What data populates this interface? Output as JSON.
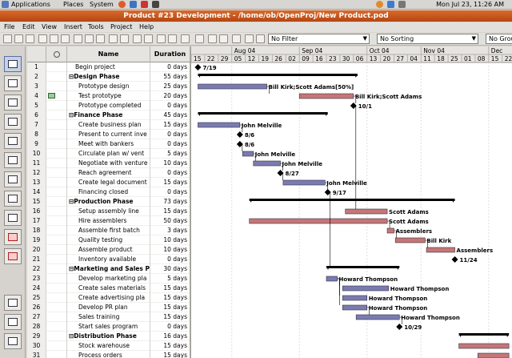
{
  "topbar": {
    "menus": [
      "Applications",
      "Places",
      "System"
    ],
    "clock": "Mon Jul 23, 11:26 AM"
  },
  "window": {
    "title": "Product #23 Development - /home/ob/OpenProj/New Product.pod"
  },
  "menubar": [
    "File",
    "Edit",
    "View",
    "Insert",
    "Tools",
    "Project",
    "Help"
  ],
  "toolbar": {
    "filter": "No Filter",
    "sorting": "No Sorting",
    "group": "No Grou"
  },
  "sidebar": {
    "icons": [
      "gantt-view-icon",
      "network-view-icon",
      "wbs-view-icon",
      "task-usage-icon",
      "resource-usage-icon",
      "resource-view-icon",
      "rbs-view-icon",
      "projects-view-icon",
      "report-icon",
      "task-sheet-icon",
      "resource-sheet-icon",
      "histogram-icon",
      "charts-icon",
      "task-usage-detail-icon"
    ]
  },
  "table": {
    "headers": [
      "",
      "Name",
      "Duration"
    ],
    "rows": [
      {
        "id": "1",
        "name": "Begin project",
        "dur": "0 days",
        "summary": false,
        "level": 0
      },
      {
        "id": "2",
        "name": "Design Phase",
        "dur": "55 days",
        "summary": true,
        "level": 0
      },
      {
        "id": "3",
        "name": "Prototype design",
        "dur": "25 days",
        "summary": false,
        "level": 1
      },
      {
        "id": "4",
        "name": "Test prototype",
        "dur": "20 days",
        "summary": false,
        "level": 1
      },
      {
        "id": "5",
        "name": "Prototype completed",
        "dur": "0 days",
        "summary": false,
        "level": 1
      },
      {
        "id": "6",
        "name": "Finance Phase",
        "dur": "45 days",
        "summary": true,
        "level": 0
      },
      {
        "id": "7",
        "name": "Create business plan",
        "dur": "15 days",
        "summary": false,
        "level": 1
      },
      {
        "id": "8",
        "name": "Present to current inve",
        "dur": "0 days",
        "summary": false,
        "level": 1
      },
      {
        "id": "9",
        "name": "Meet with bankers",
        "dur": "0 days",
        "summary": false,
        "level": 1
      },
      {
        "id": "10",
        "name": "Circulate plan w/ vent",
        "dur": "5 days",
        "summary": false,
        "level": 1
      },
      {
        "id": "11",
        "name": "Negotiate with venture",
        "dur": "10 days",
        "summary": false,
        "level": 1
      },
      {
        "id": "12",
        "name": "Reach agreement",
        "dur": "0 days",
        "summary": false,
        "level": 1
      },
      {
        "id": "13",
        "name": "Create legal document",
        "dur": "15 days",
        "summary": false,
        "level": 1
      },
      {
        "id": "14",
        "name": "Financing closed",
        "dur": "0 days",
        "summary": false,
        "level": 1
      },
      {
        "id": "15",
        "name": "Production Phase",
        "dur": "73 days",
        "summary": true,
        "level": 0
      },
      {
        "id": "16",
        "name": "Setup assembly line",
        "dur": "15 days",
        "summary": false,
        "level": 1
      },
      {
        "id": "17",
        "name": "Hire assemblers",
        "dur": "50 days",
        "summary": false,
        "level": 1
      },
      {
        "id": "18",
        "name": "Assemble first batch",
        "dur": "3 days",
        "summary": false,
        "level": 1
      },
      {
        "id": "19",
        "name": "Quality testing",
        "dur": "10 days",
        "summary": false,
        "level": 1
      },
      {
        "id": "20",
        "name": "Assemble product",
        "dur": "10 days",
        "summary": false,
        "level": 1
      },
      {
        "id": "21",
        "name": "Inventory available",
        "dur": "0 days",
        "summary": false,
        "level": 1
      },
      {
        "id": "22",
        "name": "Marketing and Sales P",
        "dur": "30 days",
        "summary": true,
        "level": 0
      },
      {
        "id": "23",
        "name": "Develop marketing pla",
        "dur": "5 days",
        "summary": false,
        "level": 1
      },
      {
        "id": "24",
        "name": "Create sales materials",
        "dur": "15 days",
        "summary": false,
        "level": 1
      },
      {
        "id": "25",
        "name": "Create advertising pla",
        "dur": "15 days",
        "summary": false,
        "level": 1
      },
      {
        "id": "26",
        "name": "Develop PR plan",
        "dur": "15 days",
        "summary": false,
        "level": 1
      },
      {
        "id": "27",
        "name": "Sales training",
        "dur": "15 days",
        "summary": false,
        "level": 1
      },
      {
        "id": "28",
        "name": "Start sales program",
        "dur": "0 days",
        "summary": false,
        "level": 1
      },
      {
        "id": "29",
        "name": "Distribution Phase",
        "dur": "16 days",
        "summary": true,
        "level": 0
      },
      {
        "id": "30",
        "name": "Stock warehouse",
        "dur": "15 days",
        "summary": false,
        "level": 1
      },
      {
        "id": "31",
        "name": "Process orders",
        "dur": "15 days",
        "summary": false,
        "level": 1
      }
    ]
  },
  "gantt": {
    "months": [
      {
        "label": "Aug 04",
        "col": 3
      },
      {
        "label": "Sep 04",
        "col": 8
      },
      {
        "label": "Oct 04",
        "col": 13
      },
      {
        "label": "Nov 04",
        "col": 17
      },
      {
        "label": "Dec",
        "col": 22
      }
    ],
    "days": [
      "15",
      "22",
      "29",
      "05",
      "12",
      "19",
      "26",
      "02",
      "09",
      "16",
      "23",
      "30",
      "06",
      "13",
      "20",
      "27",
      "04",
      "11",
      "18",
      "25",
      "01",
      "08",
      "15",
      "22"
    ],
    "bars": [
      {
        "row": 0,
        "kind": "milestone",
        "start": 0.5,
        "label": "7/19"
      },
      {
        "row": 1,
        "kind": "summary",
        "start": 0.5,
        "end": 12.3
      },
      {
        "row": 2,
        "kind": "task",
        "crit": false,
        "start": 0.5,
        "end": 5.6,
        "label": "Bill Kirk;Scott Adams[50%]"
      },
      {
        "row": 3,
        "kind": "task",
        "crit": true,
        "start": 8.0,
        "end": 12.0,
        "label": "Bill Kirk;Scott Adams"
      },
      {
        "row": 4,
        "kind": "milestone",
        "start": 12.0,
        "label": "10/1"
      },
      {
        "row": 5,
        "kind": "summary",
        "start": 0.5,
        "end": 10.1
      },
      {
        "row": 6,
        "kind": "task",
        "crit": false,
        "start": 0.5,
        "end": 3.6,
        "label": "John Melville"
      },
      {
        "row": 7,
        "kind": "milestone",
        "start": 3.6,
        "label": "8/6"
      },
      {
        "row": 8,
        "kind": "milestone",
        "start": 3.6,
        "label": "8/6"
      },
      {
        "row": 9,
        "kind": "task",
        "crit": false,
        "start": 3.8,
        "end": 4.6,
        "label": "John Melville"
      },
      {
        "row": 10,
        "kind": "task",
        "crit": false,
        "start": 4.6,
        "end": 6.6,
        "label": "John Melville"
      },
      {
        "row": 11,
        "kind": "milestone",
        "start": 6.6,
        "label": "8/27"
      },
      {
        "row": 12,
        "kind": "task",
        "crit": false,
        "start": 6.8,
        "end": 9.9,
        "label": "John Melville"
      },
      {
        "row": 13,
        "kind": "milestone",
        "start": 10.1,
        "label": "9/17"
      },
      {
        "row": 14,
        "kind": "summary",
        "start": 4.3,
        "end": 19.5
      },
      {
        "row": 15,
        "kind": "task",
        "crit": true,
        "start": 11.4,
        "end": 14.5,
        "label": "Scott Adams"
      },
      {
        "row": 16,
        "kind": "task",
        "crit": true,
        "start": 4.3,
        "end": 14.5,
        "label": "Scott Adams"
      },
      {
        "row": 17,
        "kind": "task",
        "crit": true,
        "start": 14.5,
        "end": 15.0,
        "label": "Assemblers"
      },
      {
        "row": 18,
        "kind": "task",
        "crit": true,
        "start": 15.1,
        "end": 17.3,
        "label": "Bill Kirk"
      },
      {
        "row": 19,
        "kind": "task",
        "crit": true,
        "start": 17.4,
        "end": 19.5,
        "label": "Assemblers"
      },
      {
        "row": 20,
        "kind": "milestone",
        "start": 19.5,
        "label": "11/24"
      },
      {
        "row": 21,
        "kind": "summary",
        "start": 10.0,
        "end": 15.4
      },
      {
        "row": 22,
        "kind": "task",
        "crit": false,
        "start": 10.0,
        "end": 10.8,
        "label": "Howard Thompson"
      },
      {
        "row": 23,
        "kind": "task",
        "crit": false,
        "start": 11.2,
        "end": 14.6,
        "label": "Howard Thompson"
      },
      {
        "row": 24,
        "kind": "task",
        "crit": false,
        "start": 11.2,
        "end": 13.0,
        "label": "Howard Thompson"
      },
      {
        "row": 25,
        "kind": "task",
        "crit": false,
        "start": 11.2,
        "end": 13.0,
        "label": "Howard Thompson"
      },
      {
        "row": 26,
        "kind": "task",
        "crit": false,
        "start": 12.2,
        "end": 15.4,
        "label": "Howard Thompson"
      },
      {
        "row": 27,
        "kind": "milestone",
        "start": 15.4,
        "label": "10/29"
      },
      {
        "row": 28,
        "kind": "summary",
        "start": 19.8,
        "end": 23.5
      },
      {
        "row": 29,
        "kind": "task",
        "crit": true,
        "start": 19.8,
        "end": 23.5,
        "label": ""
      },
      {
        "row": 30,
        "kind": "task",
        "crit": true,
        "start": 21.2,
        "end": 23.5,
        "label": ""
      }
    ]
  }
}
